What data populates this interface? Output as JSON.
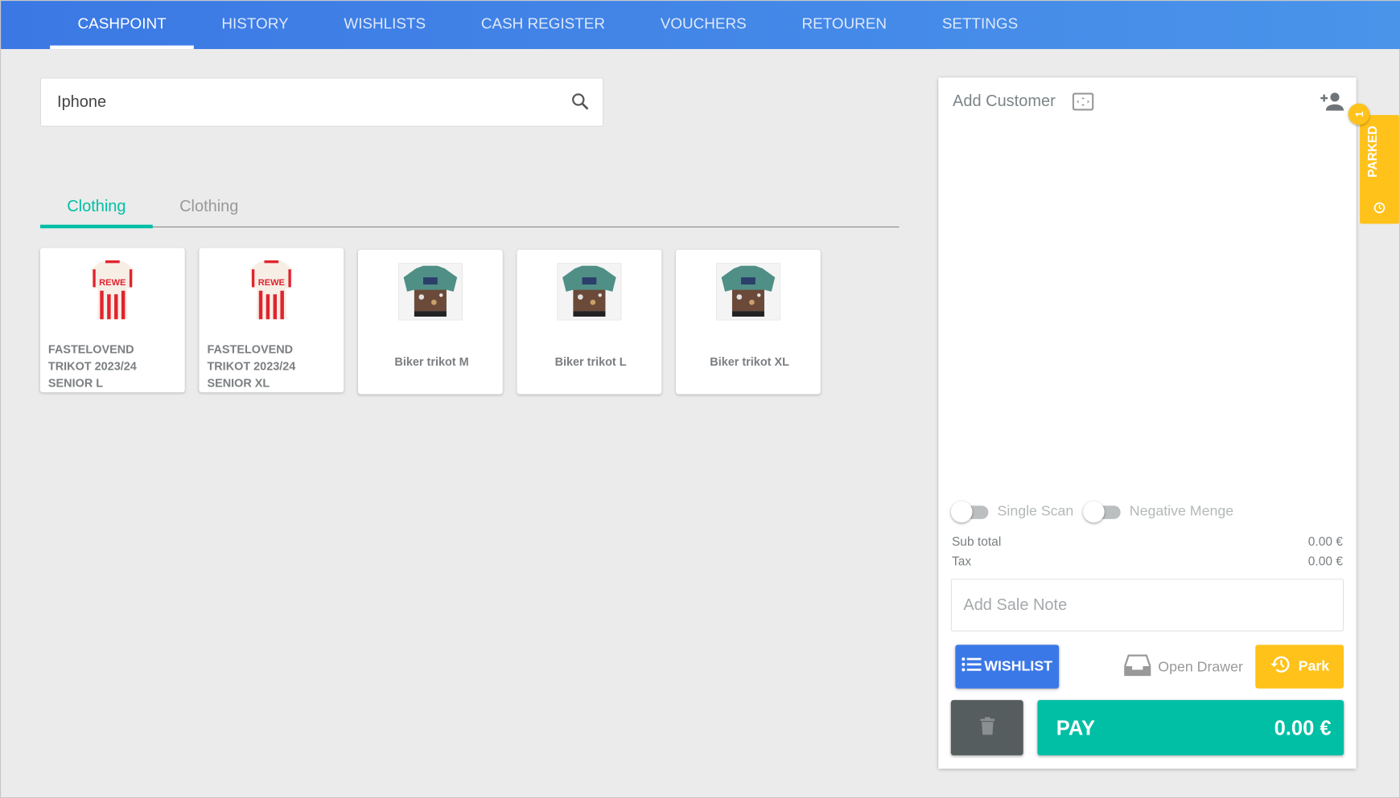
{
  "nav": {
    "tabs": [
      {
        "label": "CASHPOINT",
        "active": true
      },
      {
        "label": "HISTORY"
      },
      {
        "label": "WISHLISTS"
      },
      {
        "label": "CASH REGISTER"
      },
      {
        "label": "VOUCHERS"
      },
      {
        "label": "RETOUREN"
      },
      {
        "label": "SETTINGS"
      }
    ]
  },
  "search": {
    "value": "Iphone",
    "icon": "search-icon"
  },
  "categories": [
    {
      "label": "Clothing",
      "active": true
    },
    {
      "label": "Clothing"
    }
  ],
  "products": [
    {
      "name": "FASTELOVEND TRIKOT 2023/24 SENIOR L",
      "image": "red-white-jersey"
    },
    {
      "name": "FASTELOVEND TRIKOT 2023/24 SENIOR XL",
      "image": "red-white-jersey"
    },
    {
      "name": "Biker trikot M",
      "image": "biker-jersey"
    },
    {
      "name": "Biker trikot L",
      "image": "biker-jersey"
    },
    {
      "name": "Biker trikot XL",
      "image": "biker-jersey"
    }
  ],
  "cart": {
    "add_customer": "Add Customer",
    "toggles": {
      "single_scan": "Single Scan",
      "negative_menge": "Negative Menge"
    },
    "subtotal_label": "Sub total",
    "subtotal_value": "0.00 €",
    "tax_label": "Tax",
    "tax_value": "0.00 €",
    "note_placeholder": "Add Sale Note",
    "wishlist_label": "WISHLIST",
    "open_drawer_label": "Open Drawer",
    "park_label": "Park",
    "pay_label": "PAY",
    "pay_value": "0.00 €"
  },
  "parked": {
    "label": "PARKED",
    "count": "1"
  },
  "colors": {
    "nav": "#3b78e4",
    "accent": "#00bfa5",
    "parked": "#ffc21a",
    "wishlist": "#3b78e7",
    "trash": "#565d5f"
  }
}
